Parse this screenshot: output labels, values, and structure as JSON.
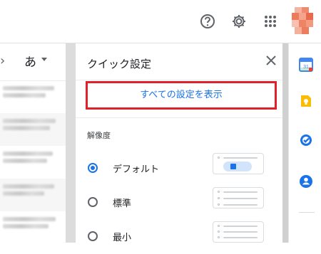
{
  "header": {
    "icons": [
      "help-icon",
      "settings-icon",
      "apps-icon"
    ],
    "avatar": "avatar"
  },
  "list_pane": {
    "nav_icon": "chevron-right-icon",
    "language_button": "あ"
  },
  "quick_settings": {
    "title": "クイック設定",
    "close_icon": "close-icon",
    "all_settings_label": "すべての設定を表示",
    "highlight_color": "#e0202a",
    "density": {
      "label": "解像度",
      "options": [
        {
          "label": "デフォルト",
          "selected": true
        },
        {
          "label": "標準",
          "selected": false
        },
        {
          "label": "最小",
          "selected": false
        }
      ]
    }
  },
  "side_panel": {
    "apps": [
      "calendar-icon",
      "keep-icon",
      "tasks-icon",
      "contacts-icon"
    ]
  },
  "colors": {
    "accent": "#1a73e8",
    "calendar_blue": "#4285f4",
    "keep_yellow": "#fbbc04"
  }
}
